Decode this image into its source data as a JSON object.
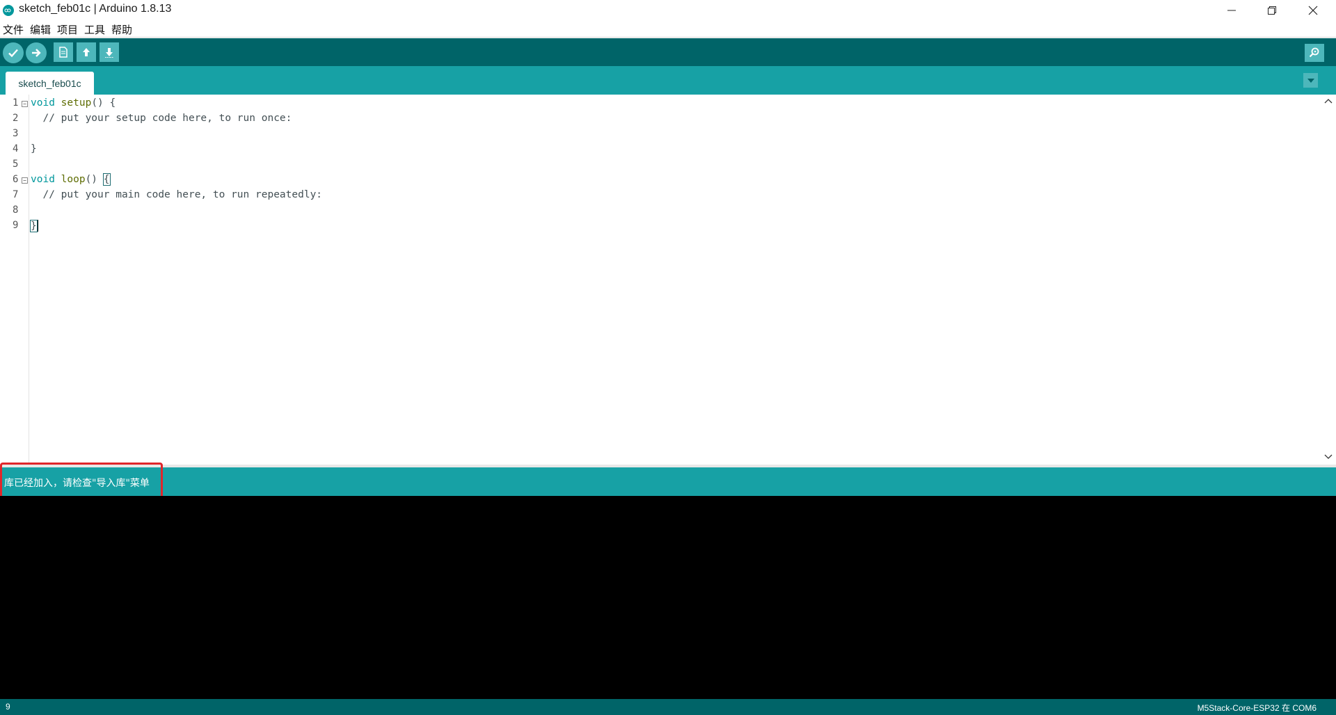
{
  "window": {
    "title": "sketch_feb01c | Arduino 1.8.13"
  },
  "menu": [
    "文件",
    "编辑",
    "项目",
    "工具",
    "帮助"
  ],
  "toolbar": {
    "buttons": [
      "verify-icon",
      "upload-icon",
      "new-icon",
      "open-icon",
      "save-icon",
      "serial-monitor-icon"
    ]
  },
  "tabs": [
    {
      "label": "sketch_feb01c",
      "active": true
    }
  ],
  "editor": {
    "line_numbers": [
      "1",
      "2",
      "3",
      "4",
      "5",
      "6",
      "7",
      "8",
      "9"
    ],
    "lines": [
      {
        "keyword": "void",
        "func": "setup",
        "rest": "() {"
      },
      {
        "comment": "  // put your setup code here, to run once:"
      },
      {
        "text": ""
      },
      {
        "text": "}"
      },
      {
        "text": ""
      },
      {
        "keyword": "void",
        "func": "loop",
        "rest": "() ",
        "brace": "{"
      },
      {
        "comment": "  // put your main code here, to run repeatedly:"
      },
      {
        "text": ""
      },
      {
        "text": "}"
      }
    ]
  },
  "status": {
    "message": "库已经加入，请检查\"导入库\"菜单"
  },
  "bottom": {
    "line": "9",
    "board": "M5Stack-Core-ESP32 在 COM6"
  },
  "colors": {
    "toolbar": "#006468",
    "tabbar": "#17a1a5",
    "button": "#4db7bb",
    "keyword": "#00979c",
    "function": "#5e6d03",
    "highlight": "#e0262b"
  }
}
